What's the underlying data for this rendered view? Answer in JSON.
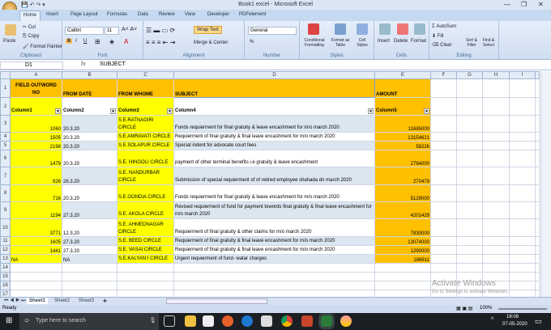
{
  "window": {
    "title": "Book1 excel - Microsoft Excel"
  },
  "ribbon_tabs": [
    "Home",
    "Insert",
    "Page Layout",
    "Formulas",
    "Data",
    "Review",
    "View",
    "Developer",
    "PDFelement"
  ],
  "clipboard": {
    "paste": "Paste",
    "cut": "Cut",
    "copy": "Copy",
    "format_painter": "Format Painter",
    "label": "Clipboard"
  },
  "font": {
    "name": "Calibri",
    "size": "11",
    "label": "Font",
    "bold": "B",
    "italic": "I",
    "underline": "U"
  },
  "alignment": {
    "wrap": "Wrap Text",
    "merge": "Merge & Center",
    "label": "Alignment"
  },
  "number": {
    "format": "General",
    "percent": "%",
    "label": "Number"
  },
  "styles": {
    "conditional": "Conditional Formatting",
    "format_table": "Format as Table",
    "cell_styles": "Cell Styles",
    "label": "Styles"
  },
  "cells": {
    "insert": "Insert",
    "delete": "Delete",
    "format": "Format",
    "label": "Cells"
  },
  "editing": {
    "autosum": "AutoSum",
    "fill": "Fill",
    "clear": "Clear",
    "sort": "Sort & Filter",
    "find": "Find & Select",
    "label": "Editing"
  },
  "formula_bar": {
    "name_box": "D1",
    "fx": "fx",
    "content": "SUBJECT"
  },
  "columns": [
    "A",
    "B",
    "C",
    "D",
    "E",
    "F",
    "G",
    "H",
    "I"
  ],
  "header_row": [
    "FIELD OUTWORD NO",
    "FROM DATE",
    "FROM WHOME",
    "SUBJECT",
    "AMOUNT"
  ],
  "table_headers": [
    "Column1",
    "Column2",
    "Column3",
    "Column4",
    "Column5"
  ],
  "rows": [
    [
      "1060",
      "20.3.20",
      "S.E.RATNAGIRI CIRCLE",
      "Funds requierment for final gratuity & leave encashment for m/o march 2020",
      "11685000"
    ],
    [
      "1505",
      "20.3.20",
      "S.E.AMRAVATI CIRCLE",
      "Requierment of final gratuity & final leave encashment for m/o march 2020",
      "13154621"
    ],
    [
      "2198",
      "20.3.20",
      "S.E.SOLAPUR   CIRCLE",
      "Special indent for advocate court fees",
      "58226"
    ],
    [
      "1479",
      "20.3.20",
      "S.E. HINGOLI  CIRCLE",
      "payment  of other terminal benefits i.e gratuity & leave encashment",
      "2764000"
    ],
    [
      "926",
      "26.3.20",
      "S.E. NANDURBAR CIRCLE",
      "Submission of special requierment of of retired employee shahada dn march 2020",
      "270479"
    ],
    [
      "716",
      "20.3.20",
      "S.E.GONDIA   CIRCLE",
      "Funds requierment for final gratuity & leave encashment for m/o march 2020",
      "5129000"
    ],
    [
      "1194",
      "27.3.20",
      "S.E. AKOLA  CIRCLE",
      "Revised requierment of fund for payment towords final gratuity & final leave encashment for m/o march 2020",
      "4201429"
    ],
    [
      "3771",
      "12.3.20",
      "S.E. AHMEDNAGAR CIRCLE",
      "Requierment of final gratuity & other claims for m/o march 2020",
      "7830000"
    ],
    [
      "1605",
      "27.3.20",
      "S.E. BEED  CIRCLE",
      "Requierment of final gratuity & final leave encashment for m/o march 2020",
      "13074000"
    ],
    [
      "1441",
      "27.3.20",
      "S.E.  VASAI  CIRCLE",
      "Requierment of final gratuity & final leave encashment for m/o march 2020",
      "1290000"
    ],
    [
      "NA",
      "NA",
      "S.E.KALYAN I CIRCLE",
      "Urgent requierment of fund- watar charges",
      "186911"
    ]
  ],
  "sheets": [
    "Sheet1",
    "Sheet2",
    "Sheet3"
  ],
  "status": {
    "ready": "Ready",
    "zoom": "100%"
  },
  "watermark": {
    "title": "Activate Windows",
    "subtitle": "Go to Settings to activate Windows."
  },
  "taskbar": {
    "search_placeholder": "Type here to search",
    "time": "18:08",
    "date": "07-05-2020"
  },
  "colors": {
    "yellow": "#ffff00",
    "orange": "#ffc000",
    "band": "#dce6f1"
  }
}
